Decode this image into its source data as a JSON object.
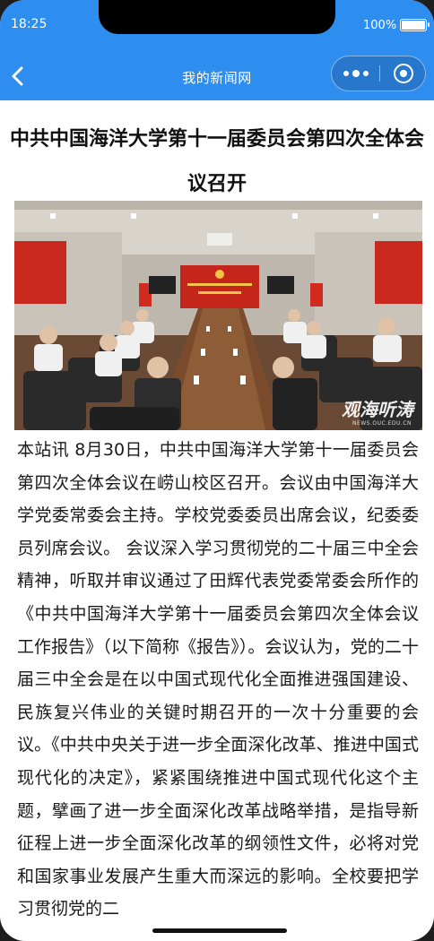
{
  "status_bar": {
    "time": "18:25",
    "battery": "100%"
  },
  "nav": {
    "title": "我的新闻网",
    "back_icon": "chevron-left-icon",
    "menu_icon": "more-dots-icon",
    "close_icon": "target-close-icon"
  },
  "article": {
    "title": "中共中国海洋大学第十一届委员会第四次全体会议召开",
    "image": {
      "banner_text_line1": "中共中国海洋大学第十一届委员会",
      "banner_text_line2": "第四次全体会议",
      "watermark": "观海听涛",
      "watermark_sub": "NEWS.OUC.EDU.CN"
    },
    "body": "本站讯 8月30日，中共中国海洋大学第十一届委员会第四次全体会议在崂山校区召开。会议由中国海洋大学党委常委会主持。学校党委委员出席会议，纪委委员列席会议。 会议深入学习贯彻党的二十届三中全会精神，听取并审议通过了田辉代表党委常委会所作的《中共中国海洋大学第十一届委员会第四次全体会议工作报告》（以下简称《报告》）。会议认为，党的二十届三中全会是在以中国式现代化全面推进强国建设、民族复兴伟业的关键时期召开的一次十分重要的会议。《中共中央关于进一步全面深化改革、推进中国式现代化的决定》，紧紧围绕推进中国式现代化这个主题，擘画了进一步全面深化改革战略举措，是指导新征程上进一步全面深化改革的纲领性文件，必将对党和国家事业发展产生重大而深远的影响。全校要把学习贯彻党的二"
  },
  "colors": {
    "nav_bg": "#2e8ef0",
    "text": "#1a1a1a"
  }
}
